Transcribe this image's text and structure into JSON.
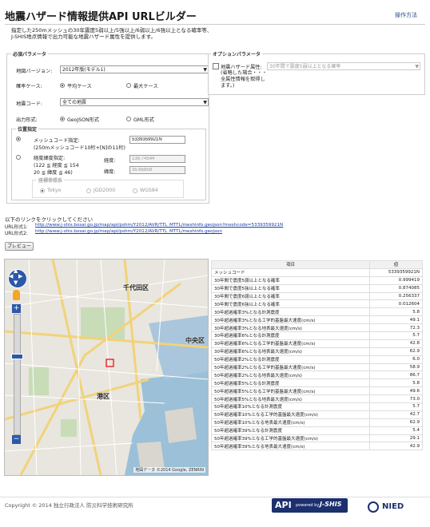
{
  "header": {
    "title": "地震ハザード情報提供API URLビルダー",
    "help": "操作方法"
  },
  "description": [
    "指定した250mメッシュの30年震度5弱以上/5強以上/6弱以上/6強以上となる確率等、",
    "J-SHIS地点情報で出力可能な地震ハザード属性を提供します。"
  ],
  "required": {
    "legend": "必須パラメータ",
    "version_label": "地図バージョン:",
    "version_value": "2012年版(モデル1)",
    "case_label": "確率ケース:",
    "case_opt1": "平均ケース",
    "case_opt2": "最大ケース",
    "quake_label": "地震コード:",
    "quake_value": "全ての地震",
    "format_label": "出力形式:",
    "format_opt1": "GeoJSON形式",
    "format_opt2": "GML形式",
    "position": {
      "legend": "位置指定",
      "mesh_label1": "メッシュコード指定:",
      "mesh_label2": "(250mメッシュコード10桁+[N]の11桁)",
      "mesh_value": "5339359921N",
      "lonlat_label1": "経度緯度指定:",
      "lonlat_label2": "(122 ≦ 経度 ≦ 154",
      "lonlat_label3": " 20  ≦ 緯度 ≦ 46)",
      "lon_label": "経度:",
      "lon_value": "139.74544",
      "lat_label": "緯度:",
      "lat_value": "35.65859",
      "datum_legend": "座標参照系",
      "datum1": "Tokyo",
      "datum2": "JGD2000",
      "datum3": "WGS84"
    }
  },
  "optional": {
    "legend": "オプションパラメータ",
    "attr_label": "地震ハザード属性:",
    "attr_note": "(省略した場合・・・全属性情報を取得します。)",
    "attr_value": "30年間で震度5弱以上となる確率"
  },
  "links": {
    "intro": "以下のリンクをクリックしてください",
    "url1_label": "URL形式1:",
    "url1": "http://www.j-shis.bosai.go.jp/map/api/pshm/Y2012/AVR/TTL_MTTL/meshinfo.geojson?meshcode=5339359921N",
    "url2_label": "URL形式2:",
    "url2": "http://www.j-shis.bosai.go.jp/map/api/pshm/Y2012/AVR/TTL_MTTL/meshinfo.geojson"
  },
  "preview_button": "プレビュー",
  "map": {
    "label1": "千代田区",
    "label2": "中央区",
    "label3": "港区",
    "credit": "地図データ ©2014 Google, ZENRIN"
  },
  "table": {
    "headers": [
      "項目",
      "値"
    ],
    "rows": [
      [
        "メッシュコード",
        "5339359921N"
      ],
      [
        "30年間で震度5弱以上となる確率",
        "0.999419"
      ],
      [
        "30年間で震度5強以上となる確率",
        "0.874085"
      ],
      [
        "30年間で震度6弱以上となる確率",
        "0.256337"
      ],
      [
        "30年間で震度6強以上となる確率",
        "0.012604"
      ],
      [
        "30年超過確率3%となる計測震度",
        "5.8"
      ],
      [
        "30年超過確率3%となる工学的基盤最大速度(cm/s)",
        "49.1"
      ],
      [
        "30年超過確率3%となる地表最大速度(cm/s)",
        "72.3"
      ],
      [
        "30年超過確率6%となる計測震度",
        "5.7"
      ],
      [
        "30年超過確率6%となる工学的基盤最大速度(cm/s)",
        "42.8"
      ],
      [
        "30年超過確率6%となる地表最大速度(cm/s)",
        "62.9"
      ],
      [
        "50年超過確率2%となる計測震度",
        "6.0"
      ],
      [
        "50年超過確率2%となる工学的基盤最大速度(cm/s)",
        "58.9"
      ],
      [
        "50年超過確率2%となる地表最大速度(cm/s)",
        "86.7"
      ],
      [
        "50年超過確率5%となる計測震度",
        "5.8"
      ],
      [
        "50年超過確率5%となる工学的基盤最大速度(cm/s)",
        "49.6"
      ],
      [
        "50年超過確率5%となる地表最大速度(cm/s)",
        "73.0"
      ],
      [
        "50年超過確率10%となる計測震度",
        "5.7"
      ],
      [
        "50年超過確率10%となる工学的基盤最大速度(cm/s)",
        "42.7"
      ],
      [
        "50年超過確率10%となる地表最大速度(cm/s)",
        "62.9"
      ],
      [
        "50年超過確率39%となる計測震度",
        "5.4"
      ],
      [
        "50年超過確率39%となる工学的基盤最大速度(cm/s)",
        "29.1"
      ],
      [
        "50年超過確率39%となる地表最大速度(cm/s)",
        "42.9"
      ]
    ]
  },
  "footer": {
    "copyright": "Copyright © 2014 独立行政法人 防災科学技術研究所",
    "api": "API",
    "powered": "powered by",
    "jshis": "J-SHIS",
    "nied": "NIED"
  }
}
